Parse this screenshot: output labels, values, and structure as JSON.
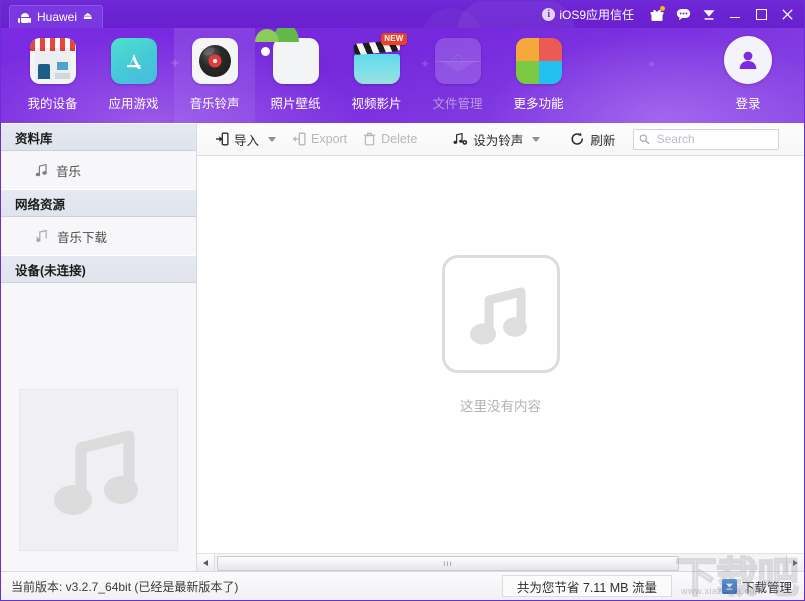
{
  "titlebar": {
    "device_tab": {
      "label": "Huawei",
      "android_icon": "android-robot-icon",
      "eject_icon": "⏏"
    },
    "ios_trust": {
      "label": "iOS9应用信任",
      "info_icon": "i"
    },
    "icons": [
      {
        "name": "gift-icon",
        "has_badge": true
      },
      {
        "name": "chat-icon",
        "has_badge": false
      },
      {
        "name": "download-icon",
        "has_badge": false
      }
    ],
    "window_controls": {
      "minimize": "—",
      "maximize": "▢",
      "close": "✕"
    }
  },
  "nav": {
    "items": [
      {
        "label": "我的设备",
        "icon": "shop-icon",
        "active": false,
        "disabled": false,
        "badge": ""
      },
      {
        "label": "应用游戏",
        "icon": "appstore-icon",
        "active": false,
        "disabled": false,
        "badge": ""
      },
      {
        "label": "音乐铃声",
        "icon": "vinyl-record-icon",
        "active": true,
        "disabled": false,
        "badge": ""
      },
      {
        "label": "照片壁纸",
        "icon": "photo-icon",
        "active": false,
        "disabled": false,
        "badge": ""
      },
      {
        "label": "视频影片",
        "icon": "clapperboard-icon",
        "active": false,
        "disabled": false,
        "badge": "NEW"
      },
      {
        "label": "文件管理",
        "icon": "folder-icon",
        "active": false,
        "disabled": true,
        "badge": ""
      },
      {
        "label": "更多功能",
        "icon": "grid-squares-icon",
        "active": false,
        "disabled": false,
        "badge": ""
      }
    ],
    "login": {
      "label": "登录",
      "icon": "person-avatar-icon"
    },
    "more_colors": [
      "#f6a93b",
      "#ec5a55",
      "#7ac943",
      "#22c0ec"
    ]
  },
  "sidebar": {
    "sections": [
      {
        "header": "资料库",
        "items": [
          {
            "label": "音乐",
            "icon": "music-note-icon",
            "selected": false
          }
        ]
      },
      {
        "header": "网络资源",
        "items": [
          {
            "label": "音乐下载",
            "icon": "music-download-icon",
            "selected": false
          }
        ]
      },
      {
        "header": "设备(未连接)",
        "items": []
      }
    ],
    "artwork_icon": "music-note-placeholder-icon"
  },
  "toolbar": {
    "import": {
      "label": "导入",
      "icon": "import-arrow-icon",
      "has_dropdown": true,
      "enabled": true
    },
    "export": {
      "label": "Export",
      "icon": "export-arrow-icon",
      "has_dropdown": false,
      "enabled": false
    },
    "delete": {
      "label": "Delete",
      "icon": "trash-icon",
      "has_dropdown": false,
      "enabled": false
    },
    "ringtone": {
      "label": "设为铃声",
      "icon": "music-gear-icon",
      "has_dropdown": true,
      "enabled": true
    },
    "refresh": {
      "label": "刷新",
      "icon": "refresh-icon",
      "has_dropdown": false,
      "enabled": true
    },
    "search": {
      "placeholder": "Search",
      "value": "",
      "icon": "search-icon"
    }
  },
  "main": {
    "empty_state": {
      "icon": "music-note-icon",
      "text": "这里没有内容"
    },
    "scrollbar": {
      "left_arrow": "◀",
      "right_arrow": "▶",
      "grip": "ııı"
    }
  },
  "statusbar": {
    "version_text": "当前版本: v3.2.7_64bit  (已经是最新版本了)",
    "saved_traffic": "共为您节省 7.11 MB 流量",
    "download_manager": {
      "label": "下载管理",
      "icon": "download-arrow-icon"
    }
  },
  "watermark": {
    "text": "下载吧",
    "url": "www.xiazaiba.com"
  },
  "colors": {
    "brand_purple": "#7b2be2",
    "titlebar_purple": "#6e26d6",
    "accent_red": "#e8402a",
    "download_blue": "#2f78cf"
  }
}
